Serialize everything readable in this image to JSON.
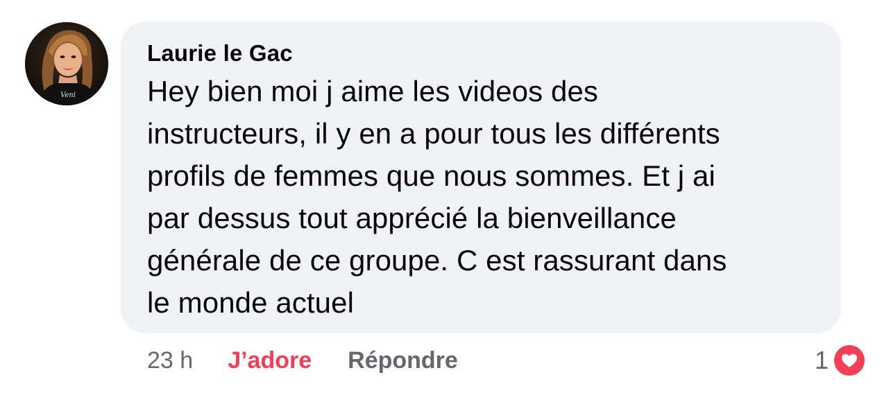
{
  "comment": {
    "author": "Laurie le Gac",
    "text_lines": [
      "Hey bien moi j aime les videos des",
      "instructeurs, il y en a pour tous les différents",
      "profils de femmes que nous sommes. Et j ai",
      "par dessus tout apprécié la bienveillance",
      "générale de ce groupe. C est rassurant dans",
      "le monde actuel"
    ],
    "time": "23 h",
    "love_label": "J’adore",
    "reply_label": "Répondre",
    "reaction_count": "1",
    "reaction_icon": "heart-icon"
  },
  "colors": {
    "bubble_bg": "#f0f2f5",
    "love_red": "#f33e58",
    "meta_gray": "#65676b"
  }
}
